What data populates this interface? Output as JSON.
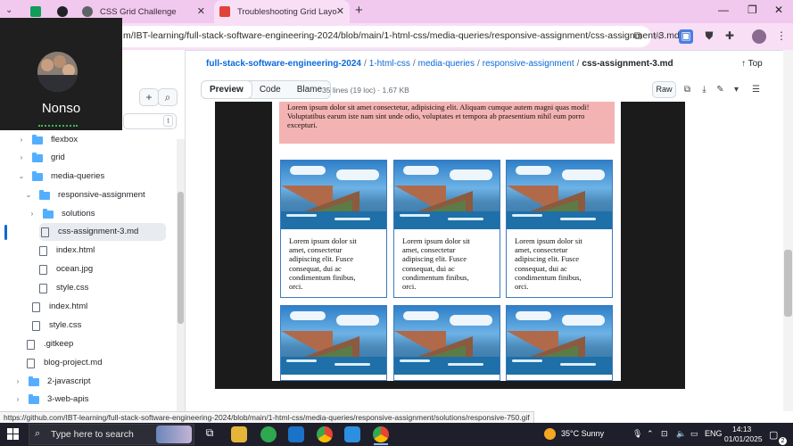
{
  "browser": {
    "tabs": [
      {
        "label": "",
        "icon": "sheets-icon",
        "color": "#0f9d58"
      },
      {
        "label": "",
        "icon": "github-icon",
        "color": "#1f2328"
      },
      {
        "label": "CSS Grid Challenge",
        "icon": "globe-icon",
        "color": "#5f6368"
      },
      {
        "label": "Troubleshooting Grid Layout Is",
        "icon": "scrimba-icon",
        "color": "#e0433a"
      }
    ],
    "url": "m/IBT-learning/full-stack-software-engineering-2024/blob/main/1-html-css/media-queries/responsive-assignment/css-assignment-3.md"
  },
  "call": {
    "name": "Nonso"
  },
  "repo": {
    "breadcrumb": [
      "full-stack-software-engineering-2024",
      "1-html-css",
      "media-queries",
      "responsive-assignment"
    ],
    "current_file": "css-assignment-3.md",
    "top_label": "Top",
    "view_tabs": [
      "Preview",
      "Code",
      "Blame"
    ],
    "file_info": "35 lines (19 loc) · 1.67 KB",
    "raw_label": "Raw"
  },
  "sidebar": {
    "filter_key": "t",
    "items": [
      {
        "label": "flexbox",
        "type": "folder",
        "caret": "›"
      },
      {
        "label": "grid",
        "type": "folder",
        "caret": "›"
      },
      {
        "label": "media-queries",
        "type": "folder",
        "caret": "⌄"
      },
      {
        "label": "responsive-assignment",
        "type": "folder",
        "caret": "⌄"
      },
      {
        "label": "solutions",
        "type": "folder",
        "caret": "›"
      },
      {
        "label": "css-assignment-3.md",
        "type": "file",
        "caret": ""
      },
      {
        "label": "index.html",
        "type": "file",
        "caret": ""
      },
      {
        "label": "ocean.jpg",
        "type": "file",
        "caret": ""
      },
      {
        "label": "style.css",
        "type": "file",
        "caret": ""
      },
      {
        "label": "index.html",
        "type": "file",
        "caret": ""
      },
      {
        "label": "style.css",
        "type": "file",
        "caret": ""
      },
      {
        "label": ".gitkeep",
        "type": "file",
        "caret": ""
      },
      {
        "label": "blog-project.md",
        "type": "file",
        "caret": ""
      },
      {
        "label": "2-javascript",
        "type": "folder",
        "caret": "›"
      },
      {
        "label": "3-web-apis",
        "type": "folder",
        "caret": "›"
      }
    ]
  },
  "preview": {
    "banner_text": "Lorem ipsum dolor sit amet consectetur, adipisicing elit. Aliquam cumque autem magni quas modi! Voluptatibus earum iste nam sint unde odio, voluptates et tempora ab praesentium nihil eum porro excepturi.",
    "card_text": "Lorem ipsum dolor sit amet, consectetur adipiscing elit. Fusce consequat, dui ac condimentum finibus, orci."
  },
  "status_url": "https://github.com/IBT-learning/full-stack-software-engineering-2024/blob/main/1-html-css/media-queries/responsive-assignment/solutions/responsive-750.gif",
  "taskbar": {
    "search_placeholder": "Type here to search",
    "weather": "35°C  Sunny",
    "language": "ENG",
    "time": "14:13",
    "date": "01/01/2025",
    "notifications": "2"
  }
}
